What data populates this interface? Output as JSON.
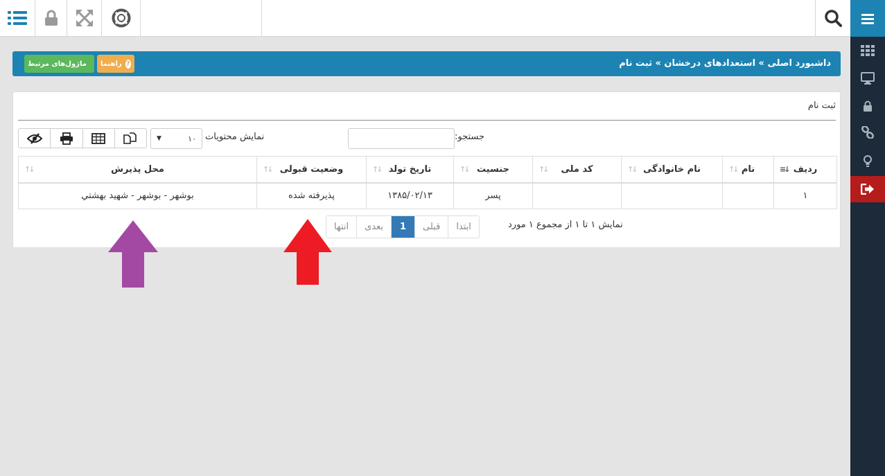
{
  "sidebar": {
    "exit_color": "#b51c1c",
    "accent": "#1c83b3",
    "items": [
      {
        "icon": "grid-icon"
      },
      {
        "icon": "monitor-icon"
      },
      {
        "icon": "lock-icon"
      },
      {
        "icon": "link-icon"
      },
      {
        "icon": "lightbulb-icon"
      },
      {
        "icon": "sign-out-icon"
      }
    ]
  },
  "topbar": {
    "icons": [
      "list-menu-icon",
      "lock-icon",
      "expand-icon",
      "lifebuoy-icon",
      "search-icon"
    ]
  },
  "breadcrumb": {
    "text": "داشبورد اصلی » استعدادهای درخشان » ثبت نام",
    "help_label": "راهنما",
    "modules_label": "ماژول‌های مرتبط"
  },
  "panel": {
    "title": "ثبت نام",
    "search_label": "جستجو:",
    "search_value": "",
    "length_label": "نمایش محتویات",
    "length_value": "۱۰",
    "tools": [
      "copy-icon",
      "table-icon",
      "print-icon",
      "eye-slash-icon"
    ]
  },
  "table": {
    "headers": [
      "ردیف",
      "نام",
      "نام خانوادگی",
      "کد ملی",
      "جنسیت",
      "تاریخ تولد",
      "وضعیت قبولی",
      "محل پذیرش"
    ],
    "rows": [
      [
        "۱",
        "",
        "",
        "",
        "پسر",
        "۱۳۸۵/۰۲/۱۳",
        "پذیرفته شده",
        "بوشهر - بوشهر - شهید بهشتي"
      ]
    ]
  },
  "footer": {
    "info": "نمایش ۱ تا ۱ از مجموع ۱ مورد",
    "pager": [
      "ابتدا",
      "قبلی",
      "1",
      "بعدی",
      "انتها"
    ],
    "active_page": "1"
  },
  "annotations": {
    "arrow_colors": [
      "#a349a4",
      "#ed1c24"
    ]
  }
}
